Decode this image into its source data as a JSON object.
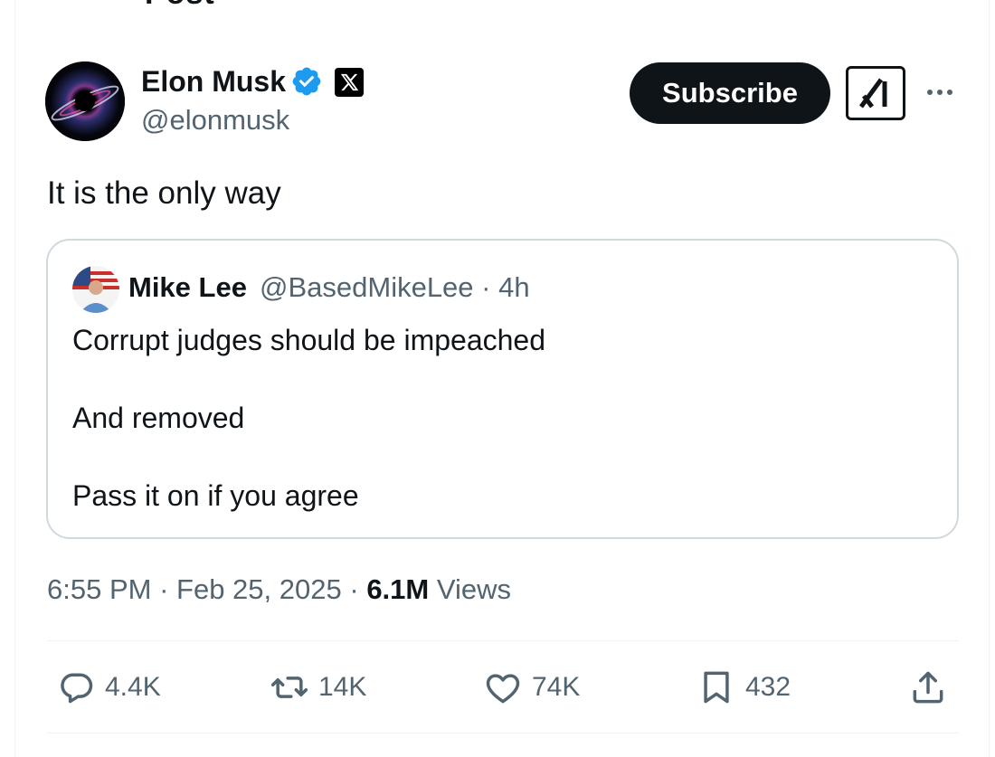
{
  "header": {
    "cut_title": "Post"
  },
  "author": {
    "name": "Elon Musk",
    "handle": "@elonmusk"
  },
  "buttons": {
    "subscribe": "Subscribe"
  },
  "tweet": {
    "text": "It is the only way"
  },
  "quote": {
    "name": "Mike Lee",
    "handle": "@BasedMikeLee",
    "separator": "·",
    "time": "4h",
    "lines": [
      "Corrupt judges should be impeached",
      "And removed",
      "Pass it on if you agree"
    ]
  },
  "meta": {
    "time": "6:55 PM",
    "date": "Feb 25, 2025",
    "sep": "·",
    "views_count": "6.1M",
    "views_label": "Views"
  },
  "actions": {
    "replies": "4.4K",
    "reposts": "14K",
    "likes": "74K",
    "bookmarks": "432"
  },
  "colors": {
    "text": "#0f1419",
    "secondary": "#536471",
    "verified": "#1d9bf0",
    "border": "#cfd9de"
  }
}
